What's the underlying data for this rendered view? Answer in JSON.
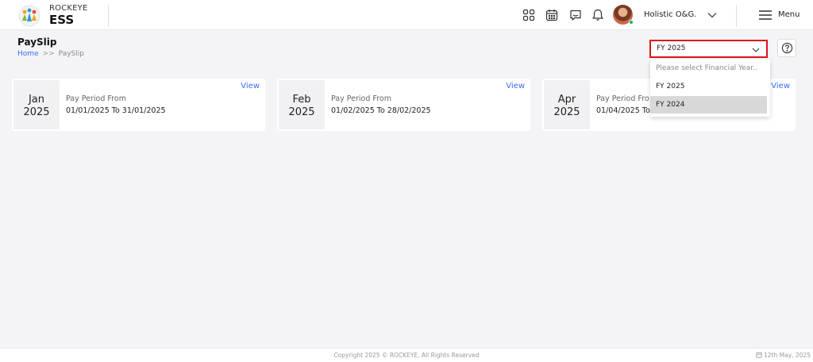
{
  "header": {
    "brand_top": "ROCKEYE",
    "brand_main": "ESS",
    "org_name": "Holistic O&G.",
    "menu_label": "Menu",
    "icons": [
      "apps-grid-icon",
      "calendar-icon",
      "chat-icon",
      "bell-icon"
    ]
  },
  "page": {
    "title": "PaySlip",
    "breadcrumb": {
      "home": "Home",
      "separator": ">>",
      "current": "PaySlip"
    }
  },
  "fy_select": {
    "value": "FY 2025",
    "options": [
      {
        "label": "Please select Financial Year..",
        "placeholder": true
      },
      {
        "label": "FY 2025"
      },
      {
        "label": "FY 2024",
        "highlighted": true
      }
    ]
  },
  "cards": [
    {
      "month": "Jan",
      "year": "2025",
      "period_label": "Pay Period From",
      "period_range": "01/01/2025 To 31/01/2025",
      "view_label": "View"
    },
    {
      "month": "Feb",
      "year": "2025",
      "period_label": "Pay Period From",
      "period_range": "01/02/2025 To 28/02/2025",
      "view_label": "View"
    },
    {
      "month": "Apr",
      "year": "2025",
      "period_label": "Pay Period Fro",
      "period_range": "01/04/2025 To",
      "view_label": "View"
    }
  ],
  "footer": {
    "copyright": "Copyright 2025 © ROCKEYE, All Rights Reserved",
    "date": "12th May, 2025"
  },
  "colors": {
    "accent": "#3a6cf4",
    "highlight_border": "#d9141d",
    "online": "#2bb24c"
  }
}
